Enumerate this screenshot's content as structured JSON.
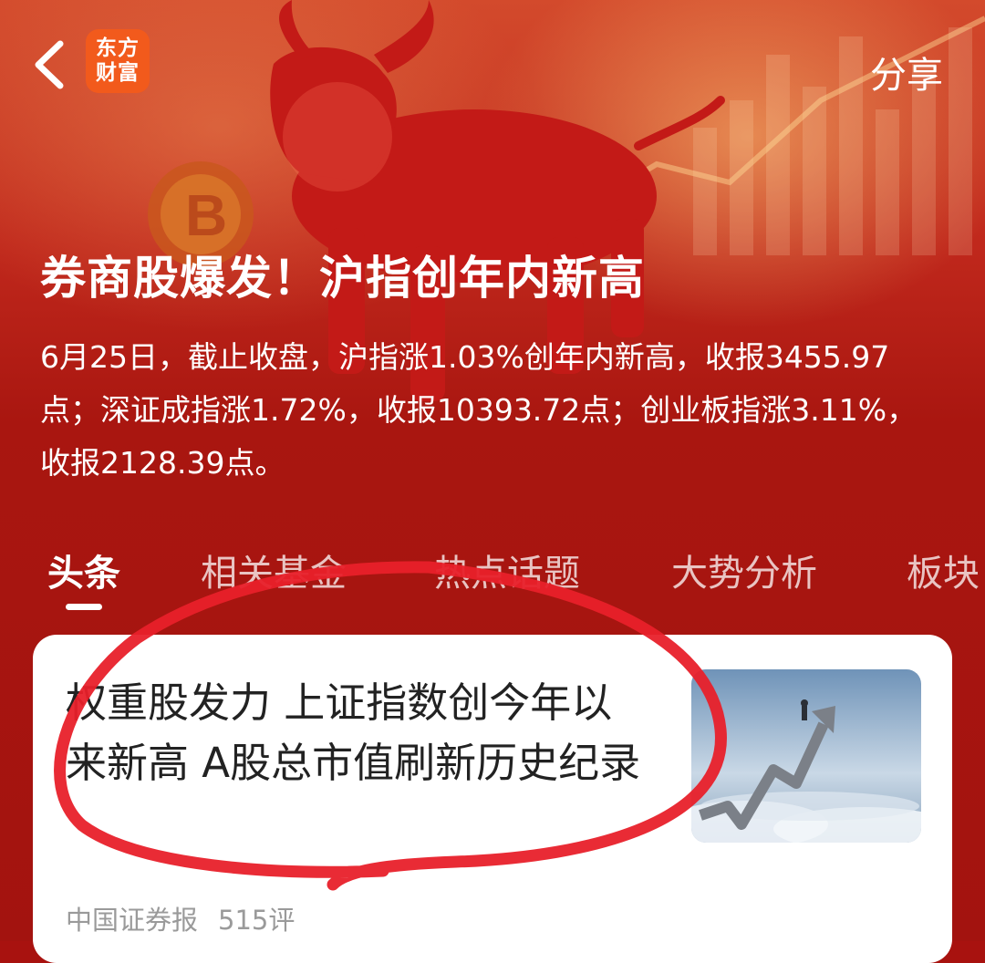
{
  "header": {
    "logo_line1": "东方",
    "logo_line2": "财富",
    "share_label": "分享"
  },
  "topic": {
    "title": "券商股爆发！沪指创年内新高",
    "summary": "6月25日，截止收盘，沪指涨1.03%创年内新高，收报3455.97点；深证成指涨1.72%，收报10393.72点；创业板指涨3.11%，收报2128.39点。"
  },
  "tabs": [
    {
      "label": "头条",
      "active": true
    },
    {
      "label": "相关基金",
      "active": false
    },
    {
      "label": "热点话题",
      "active": false
    },
    {
      "label": "大势分析",
      "active": false
    },
    {
      "label": "板块",
      "active": false
    }
  ],
  "article": {
    "title": "权重股发力 上证指数创今年以来新高 A股总市值刷新历史纪录",
    "source": "中国证券报",
    "comments": "515评"
  },
  "colors": {
    "hero_red": "#a8120f",
    "logo_orange": "#f25a1c",
    "annotation_red": "#e8202a"
  },
  "icons": {
    "back": "chevron-left-icon",
    "hero": "bull-illustration",
    "thumbnail": "rising-arrow-stairs-image"
  }
}
